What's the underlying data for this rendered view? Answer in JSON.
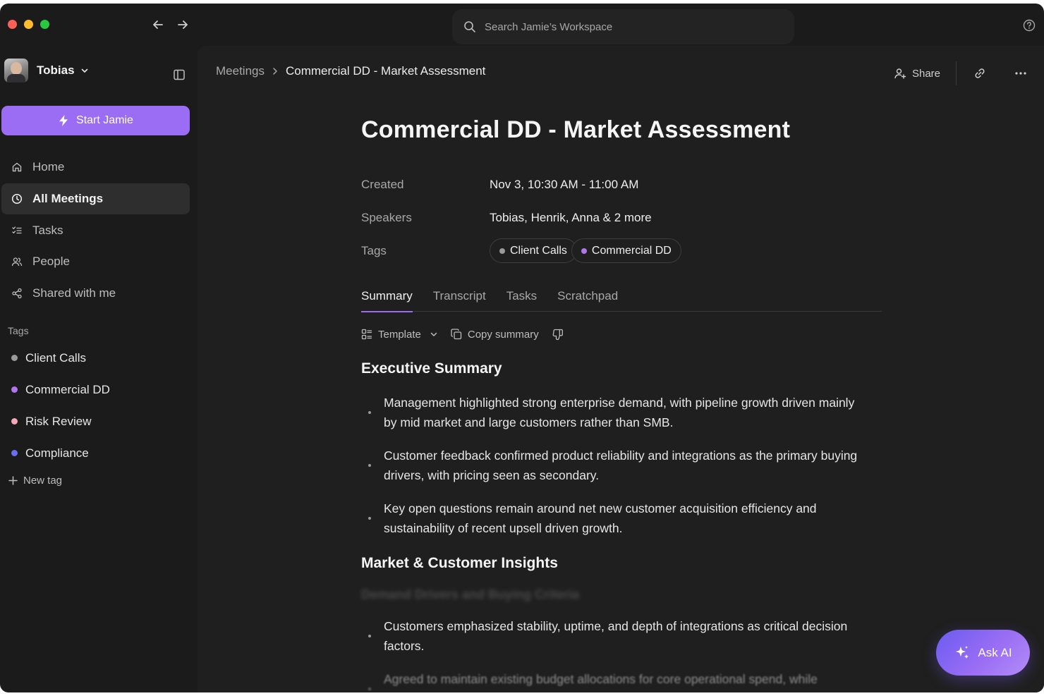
{
  "search": {
    "placeholder": "Search Jamie’s Workspace"
  },
  "sidebar": {
    "user_name": "Tobias",
    "start_button": "Start Jamie",
    "nav": [
      {
        "label": "Home",
        "icon": "home-icon"
      },
      {
        "label": "All Meetings",
        "icon": "clock-icon",
        "active": true
      },
      {
        "label": "Tasks",
        "icon": "checklist-icon"
      },
      {
        "label": "People",
        "icon": "people-icon"
      },
      {
        "label": "Shared with me",
        "icon": "share-icon"
      }
    ],
    "tags_heading": "Tags",
    "tags": [
      {
        "label": "Client Calls",
        "color": "#9a9a9a"
      },
      {
        "label": "Commercial DD",
        "color": "#b076f0"
      },
      {
        "label": "Risk Review",
        "color": "#f4a9b8"
      },
      {
        "label": "Compliance",
        "color": "#6a6ef2"
      }
    ],
    "new_tag": "New tag"
  },
  "breadcrumb": {
    "parent": "Meetings",
    "current": "Commercial DD - Market Assessment"
  },
  "actions": {
    "share": "Share"
  },
  "meeting": {
    "title": "Commercial DD - Market Assessment",
    "created_label": "Created",
    "created_value": "Nov 3, 10:30 AM - 11:00 AM",
    "speakers_label": "Speakers",
    "speakers_value": "Tobias, Henrik, Anna & 2 more",
    "tags_label": "Tags",
    "tags": [
      {
        "label": "Client Calls",
        "color": "#9a9a9a"
      },
      {
        "label": "Commercial DD",
        "color": "#b076f0"
      }
    ]
  },
  "tabs": [
    "Summary",
    "Transcript",
    "Tasks",
    "Scratchpad"
  ],
  "toolbar": {
    "template": "Template",
    "copy": "Copy summary"
  },
  "summary": {
    "section1_title": "Executive Summary",
    "section1_bullets": [
      "Management highlighted strong enterprise demand, with pipeline growth driven mainly by mid market and large customers rather than SMB.",
      "Customer feedback confirmed product reliability and integrations as the primary buying drivers, with pricing seen as secondary.",
      "Key open questions remain around net new customer acquisition efficiency and sustainability of recent upsell driven growth."
    ],
    "section2_title": "Market & Customer Insights",
    "section2_subtitle": "Demand Drivers and Buying Criteria",
    "section2_bullets": [
      "Customers emphasized stability, uptime, and depth of integrations as critical decision factors."
    ],
    "section2_partial": "Agreed to maintain existing budget allocations for core operational spend, while"
  },
  "ask_ai": "Ask AI",
  "colors": {
    "accent": "#9a6df4",
    "window_bg": "#1b1b1b",
    "panel_bg": "#1f1f1f"
  }
}
